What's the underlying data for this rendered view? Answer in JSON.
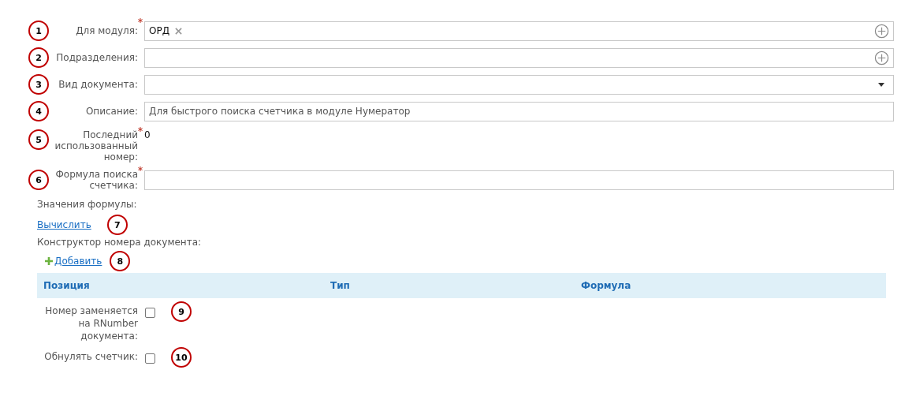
{
  "fields": [
    {
      "marker": "1",
      "label": "Для модуля:",
      "required": true,
      "kind": "tags",
      "tags": [
        "ОРД"
      ]
    },
    {
      "marker": "2",
      "label": "Подразделения:",
      "required": false,
      "kind": "picker"
    },
    {
      "marker": "3",
      "label": "Вид документа:",
      "required": false,
      "kind": "select"
    },
    {
      "marker": "4",
      "label": "Описание:",
      "required": false,
      "kind": "text",
      "value": "Для быстрого поиска счетчика в модуле Нумератор"
    },
    {
      "marker": "5",
      "label": "Последний использованный номер:",
      "required": true,
      "kind": "value",
      "value": "0"
    },
    {
      "marker": "6",
      "label": "Формула поиска счетчика:",
      "required": true,
      "kind": "text"
    }
  ],
  "formula_values_label": "Значения формулы:",
  "calculate_link": {
    "label": "Вычислить",
    "marker": "7"
  },
  "constructor_label": "Конструктор номера документа:",
  "add_link": {
    "label": "Добавить",
    "marker": "8"
  },
  "table": {
    "columns": [
      "Позиция",
      "Тип",
      "Формула"
    ]
  },
  "checkboxes": [
    {
      "label": "Номер заменяется на RNumber документа:",
      "checked": false,
      "marker": "9"
    },
    {
      "label": "Обнулять счетчик:",
      "checked": false,
      "marker": "10"
    }
  ]
}
